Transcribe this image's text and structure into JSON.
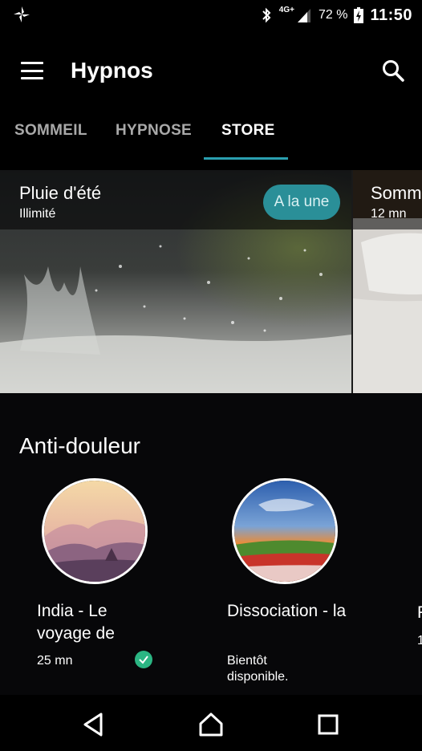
{
  "status_bar": {
    "network": "4G+",
    "battery": "72 %",
    "time": "11:50"
  },
  "app_bar": {
    "title": "Hypnos"
  },
  "tabs": [
    {
      "label": "SOMMEIL",
      "active": false
    },
    {
      "label": "HYPNOSE",
      "active": false
    },
    {
      "label": "STORE",
      "active": true
    }
  ],
  "featured": [
    {
      "title": "Pluie d'été",
      "subtitle": "Illimité",
      "badge": "A la une"
    },
    {
      "title": "Somm",
      "subtitle": "12 mn"
    }
  ],
  "section": {
    "title": "Anti-douleur",
    "items": [
      {
        "title": "India - Le voyage de",
        "subtitle": "25 mn",
        "owned": true
      },
      {
        "title": "Dissociation - la",
        "subtitle": "Bientôt disponible.",
        "owned": false
      },
      {
        "title": "F",
        "subtitle": "1"
      }
    ]
  },
  "colors": {
    "accent": "#2a9fb0",
    "badge": "#2a8f98",
    "check": "#2bb583"
  }
}
